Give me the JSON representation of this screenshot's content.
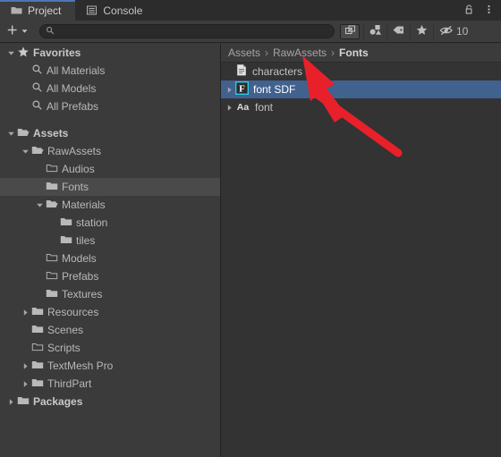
{
  "window": {
    "tabs": [
      {
        "label": "Project",
        "icon": "folder-icon",
        "active": true
      },
      {
        "label": "Console",
        "icon": "console-icon",
        "active": false
      }
    ],
    "controls": [
      {
        "name": "lock-icon",
        "label": ""
      },
      {
        "name": "kebab-menu-icon",
        "label": ""
      }
    ]
  },
  "toolbar": {
    "create_label": "+",
    "create_dropdown_icon": "chevron-down-icon",
    "search": {
      "value": "",
      "placeholder": "",
      "icon": "search-icon"
    },
    "buttons": [
      {
        "name": "open-in-new-window-icon",
        "label": ""
      },
      {
        "name": "type-filter-icon",
        "label": ""
      },
      {
        "name": "label-tag-icon",
        "label": ""
      },
      {
        "name": "favorite-star-icon",
        "label": ""
      }
    ],
    "hidden_count": "10",
    "hidden_icon": "eye-off-icon"
  },
  "sidebar": {
    "items": [
      {
        "label": "Favorites",
        "indent": 0,
        "arrow": "down",
        "icon": "star-icon",
        "bold": true,
        "selected": false
      },
      {
        "label": "All Materials",
        "indent": 1,
        "arrow": "none",
        "icon": "search-icon",
        "bold": false,
        "selected": false
      },
      {
        "label": "All Models",
        "indent": 1,
        "arrow": "none",
        "icon": "search-icon",
        "bold": false,
        "selected": false
      },
      {
        "label": "All Prefabs",
        "indent": 1,
        "arrow": "none",
        "icon": "search-icon",
        "bold": false,
        "selected": false
      },
      {
        "label": "__SPACER__",
        "indent": 0,
        "arrow": "none",
        "icon": "none",
        "bold": false,
        "selected": false
      },
      {
        "label": "Assets",
        "indent": 0,
        "arrow": "down",
        "icon": "folder-open-icon",
        "bold": true,
        "selected": false
      },
      {
        "label": "RawAssets",
        "indent": 1,
        "arrow": "down",
        "icon": "folder-open-icon",
        "bold": false,
        "selected": false
      },
      {
        "label": "Audios",
        "indent": 2,
        "arrow": "none",
        "icon": "folder-empty-icon",
        "bold": false,
        "selected": false
      },
      {
        "label": "Fonts",
        "indent": 2,
        "arrow": "none",
        "icon": "folder-icon",
        "bold": false,
        "selected": true
      },
      {
        "label": "Materials",
        "indent": 2,
        "arrow": "down",
        "icon": "folder-open-icon",
        "bold": false,
        "selected": false
      },
      {
        "label": "station",
        "indent": 3,
        "arrow": "none",
        "icon": "folder-icon",
        "bold": false,
        "selected": false
      },
      {
        "label": "tiles",
        "indent": 3,
        "arrow": "none",
        "icon": "folder-icon",
        "bold": false,
        "selected": false
      },
      {
        "label": "Models",
        "indent": 2,
        "arrow": "none",
        "icon": "folder-empty-icon",
        "bold": false,
        "selected": false
      },
      {
        "label": "Prefabs",
        "indent": 2,
        "arrow": "none",
        "icon": "folder-empty-icon",
        "bold": false,
        "selected": false
      },
      {
        "label": "Textures",
        "indent": 2,
        "arrow": "none",
        "icon": "folder-icon",
        "bold": false,
        "selected": false
      },
      {
        "label": "Resources",
        "indent": 1,
        "arrow": "right",
        "icon": "folder-icon",
        "bold": false,
        "selected": false
      },
      {
        "label": "Scenes",
        "indent": 1,
        "arrow": "none",
        "icon": "folder-icon",
        "bold": false,
        "selected": false
      },
      {
        "label": "Scripts",
        "indent": 1,
        "arrow": "none",
        "icon": "folder-empty-icon",
        "bold": false,
        "selected": false
      },
      {
        "label": "TextMesh Pro",
        "indent": 1,
        "arrow": "right",
        "icon": "folder-icon",
        "bold": false,
        "selected": false
      },
      {
        "label": "ThirdPart",
        "indent": 1,
        "arrow": "right",
        "icon": "folder-icon",
        "bold": false,
        "selected": false
      },
      {
        "label": "Packages",
        "indent": 0,
        "arrow": "right",
        "icon": "folder-icon",
        "bold": true,
        "selected": false
      }
    ]
  },
  "content": {
    "breadcrumb": [
      {
        "label": "Assets",
        "current": false
      },
      {
        "label": "RawAssets",
        "current": false
      },
      {
        "label": "Fonts",
        "current": true
      }
    ],
    "separator": "›",
    "files": [
      {
        "label": "characters",
        "arrow": "none",
        "icon": "text-document-icon",
        "selected": false
      },
      {
        "label": "font SDF",
        "arrow": "right",
        "icon": "tmp-font-asset-icon",
        "selected": true
      },
      {
        "label": "font",
        "arrow": "right",
        "icon": "font-asset-icon",
        "selected": false
      }
    ]
  },
  "annotation": {
    "type": "arrow",
    "color": "#e8202a",
    "points_to": "font SDF"
  },
  "colors": {
    "tab_accent": "#4a77b8",
    "selection": "#41618f",
    "panel_left": "#3b3b3b",
    "panel_right": "#333333",
    "toolbar": "#3c3c3c",
    "tabbar": "#2c2c2c",
    "text": "#b9b9b9",
    "icon_highlight": "#2ec8e6"
  }
}
